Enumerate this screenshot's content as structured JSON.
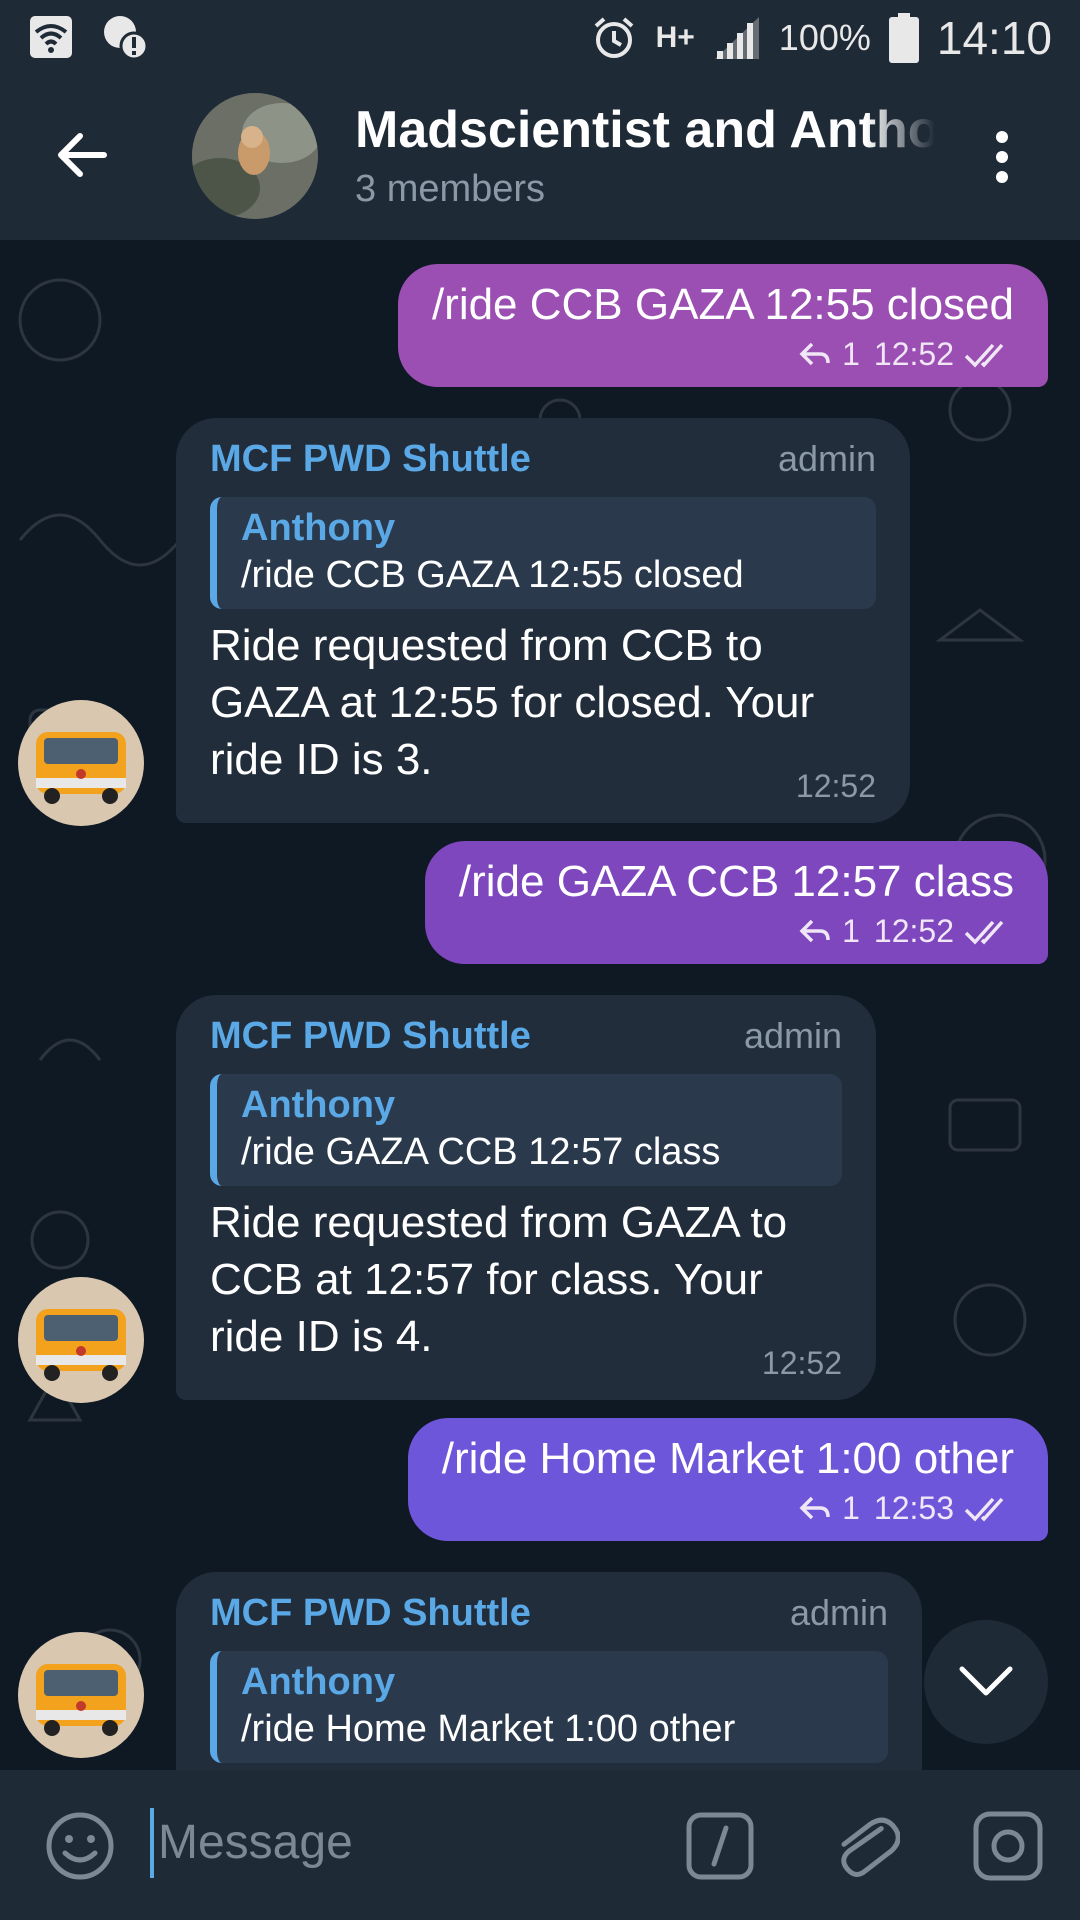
{
  "status_bar": {
    "network": "H+",
    "battery": "100%",
    "time": "14:10"
  },
  "header": {
    "title": "Madscientist and Anthony",
    "subtitle": "3 members"
  },
  "messages": [
    {
      "type": "out",
      "text": "/ride CCB GAZA 12:55 closed",
      "replies": "1",
      "time": "12:52",
      "color": "#9b4fb2"
    },
    {
      "type": "in",
      "sender": "MCF PWD Shuttle",
      "role": "admin",
      "quote_name": "Anthony",
      "quote_text": "/ride CCB GAZA 12:55 closed",
      "text": "Ride requested from CCB to GAZA at 12:55 for closed. Your ride ID is 3.",
      "time": "12:52"
    },
    {
      "type": "out",
      "text": "/ride GAZA CCB 12:57 class",
      "replies": "1",
      "time": "12:52",
      "color": "#7e47bd"
    },
    {
      "type": "in",
      "sender": "MCF PWD Shuttle",
      "role": "admin",
      "quote_name": "Anthony",
      "quote_text": "/ride GAZA CCB 12:57 class",
      "text": "Ride requested from GAZA to CCB at 12:57 for class. Your ride ID is 4.",
      "time": "12:52"
    },
    {
      "type": "out",
      "text": "/ride Home Market 1:00 other",
      "replies": "1",
      "time": "12:53",
      "color": "#6d56d9"
    },
    {
      "type": "in",
      "sender": "MCF PWD Shuttle",
      "role": "admin",
      "quote_name": "Anthony",
      "quote_text": "/ride Home Market 1:00 other"
    }
  ],
  "input": {
    "placeholder": "Message"
  },
  "colors": {
    "accent": "#5aa8e6",
    "header_bg": "#1f2a37",
    "incoming_bubble": "#212d3b"
  }
}
